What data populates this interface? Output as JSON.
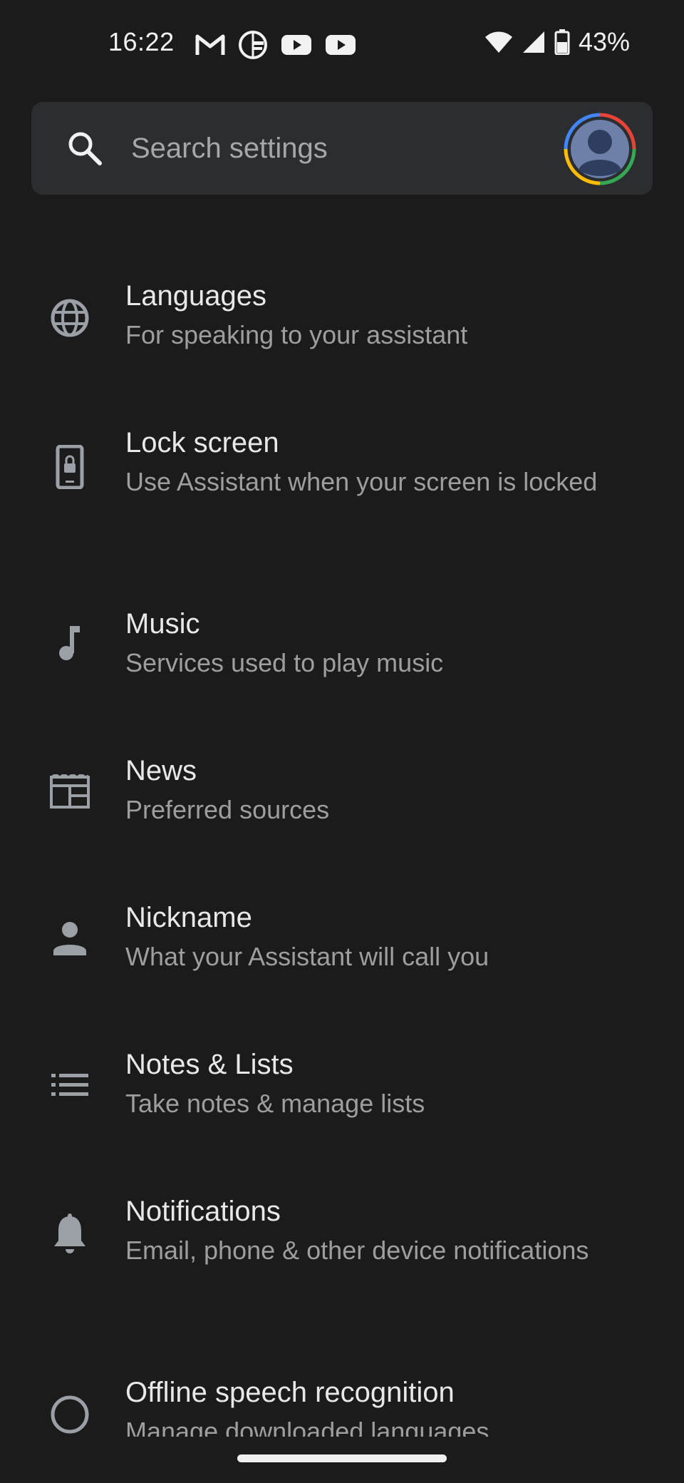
{
  "status_bar": {
    "time": "16:22",
    "left_icons": [
      "gmail-icon",
      "gnews-icon",
      "youtube-icon",
      "youtube-icon"
    ],
    "battery_percent": "43%"
  },
  "search": {
    "placeholder": "Search settings"
  },
  "settings": [
    {
      "icon": "globe-icon",
      "title": "Languages",
      "subtitle": "For speaking to your assistant"
    },
    {
      "icon": "lock-screen-icon",
      "title": "Lock screen",
      "subtitle": "Use Assistant when your screen is locked"
    },
    {
      "icon": "music-note-icon",
      "title": "Music",
      "subtitle": "Services used to play music"
    },
    {
      "icon": "newspaper-icon",
      "title": "News",
      "subtitle": "Preferred sources"
    },
    {
      "icon": "person-icon",
      "title": "Nickname",
      "subtitle": "What your Assistant will call you"
    },
    {
      "icon": "list-icon",
      "title": "Notes & Lists",
      "subtitle": "Take notes & manage lists"
    },
    {
      "icon": "bell-icon",
      "title": "Notifications",
      "subtitle": "Email, phone & other device notifications"
    },
    {
      "icon": "speech-icon",
      "title": "Offline speech recognition",
      "subtitle": "Manage downloaded languages"
    }
  ],
  "colors": {
    "background": "#1b1b1b",
    "search_bar": "#2c2d30",
    "title_text": "#e8e8e8",
    "subtitle_text": "#9e9e9e",
    "icon": "#9aa0a6"
  }
}
